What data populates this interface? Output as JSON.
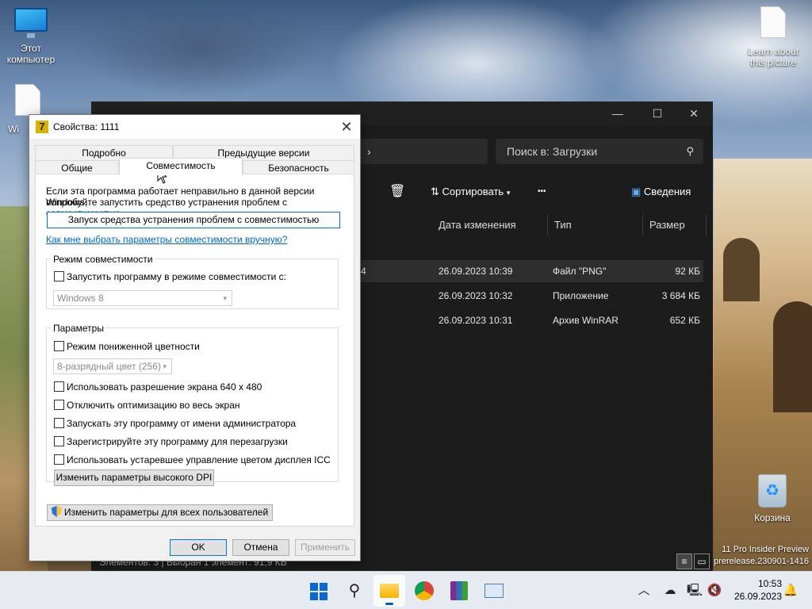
{
  "desktop": {
    "icons": [
      {
        "label": "Этот компьютер"
      },
      {
        "label": "Wi"
      },
      {
        "label": "Learn about this picture"
      },
      {
        "label": "Корзина"
      }
    ],
    "watermark_line1": "11 Pro Insider Preview",
    "watermark_line2": "prerelease.230901-1416"
  },
  "explorer": {
    "addr_chevron": "›",
    "search_placeholder": "Поиск в: Загрузки",
    "toolbar": {
      "sort_label": "Сортировать",
      "more_label": "•••",
      "details_label": "Сведения"
    },
    "columns": [
      "Дата изменения",
      "Тип",
      "Размер"
    ],
    "rows": [
      {
        "name_tail": "4",
        "date": "26.09.2023 10:39",
        "type": "Файл \"PNG\"",
        "size": "92 КБ"
      },
      {
        "name_tail": "",
        "date": "26.09.2023 10:32",
        "type": "Приложение",
        "size": "3 684 КБ"
      },
      {
        "name_tail": "",
        "date": "26.09.2023 10:31",
        "type": "Архив WinRAR",
        "size": "652 КБ"
      }
    ],
    "status": "Элементов: 3  |  Выбран 1 элемент: 91,9 КБ"
  },
  "dialog": {
    "title": "Свойства: 1111",
    "tabs_top": [
      "Подробно",
      "Предыдущие версии"
    ],
    "tabs_bottom": [
      "Общие",
      "Совместимость",
      "Безопасность"
    ],
    "intro_line1": "Если эта программа работает неправильно в данной версии Windows,",
    "intro_line2": "попробуйте запустить средство устранения проблем с совместимостью.",
    "troubleshoot_button": "Запуск средства устранения проблем с совместимостью",
    "manual_link": "Как мне выбрать параметры совместимости вручную?",
    "compat_group": {
      "label": "Режим совместимости",
      "checkbox": "Запустить программу в режиме совместимости с:",
      "os_value": "Windows 8"
    },
    "params_group": {
      "label": "Параметры",
      "reduced_color": "Режим пониженной цветности",
      "color_value": "8-разрядный цвет (256)",
      "res640": "Использовать разрешение экрана 640 x 480",
      "disable_fullscreen": "Отключить оптимизацию во весь экран",
      "run_admin": "Запускать эту программу от имени администратора",
      "register_restart": "Зарегистрируйте эту программу для перезагрузки",
      "legacy_icc": "Использовать устаревшее управление цветом дисплея ICC",
      "dpi_button": "Изменить параметры высокого DPI"
    },
    "all_users_button": "Изменить параметры для всех пользователей",
    "ok": "OK",
    "cancel": "Отмена",
    "apply": "Применить"
  },
  "taskbar": {
    "time": "10:53",
    "date": "26.09.2023"
  }
}
